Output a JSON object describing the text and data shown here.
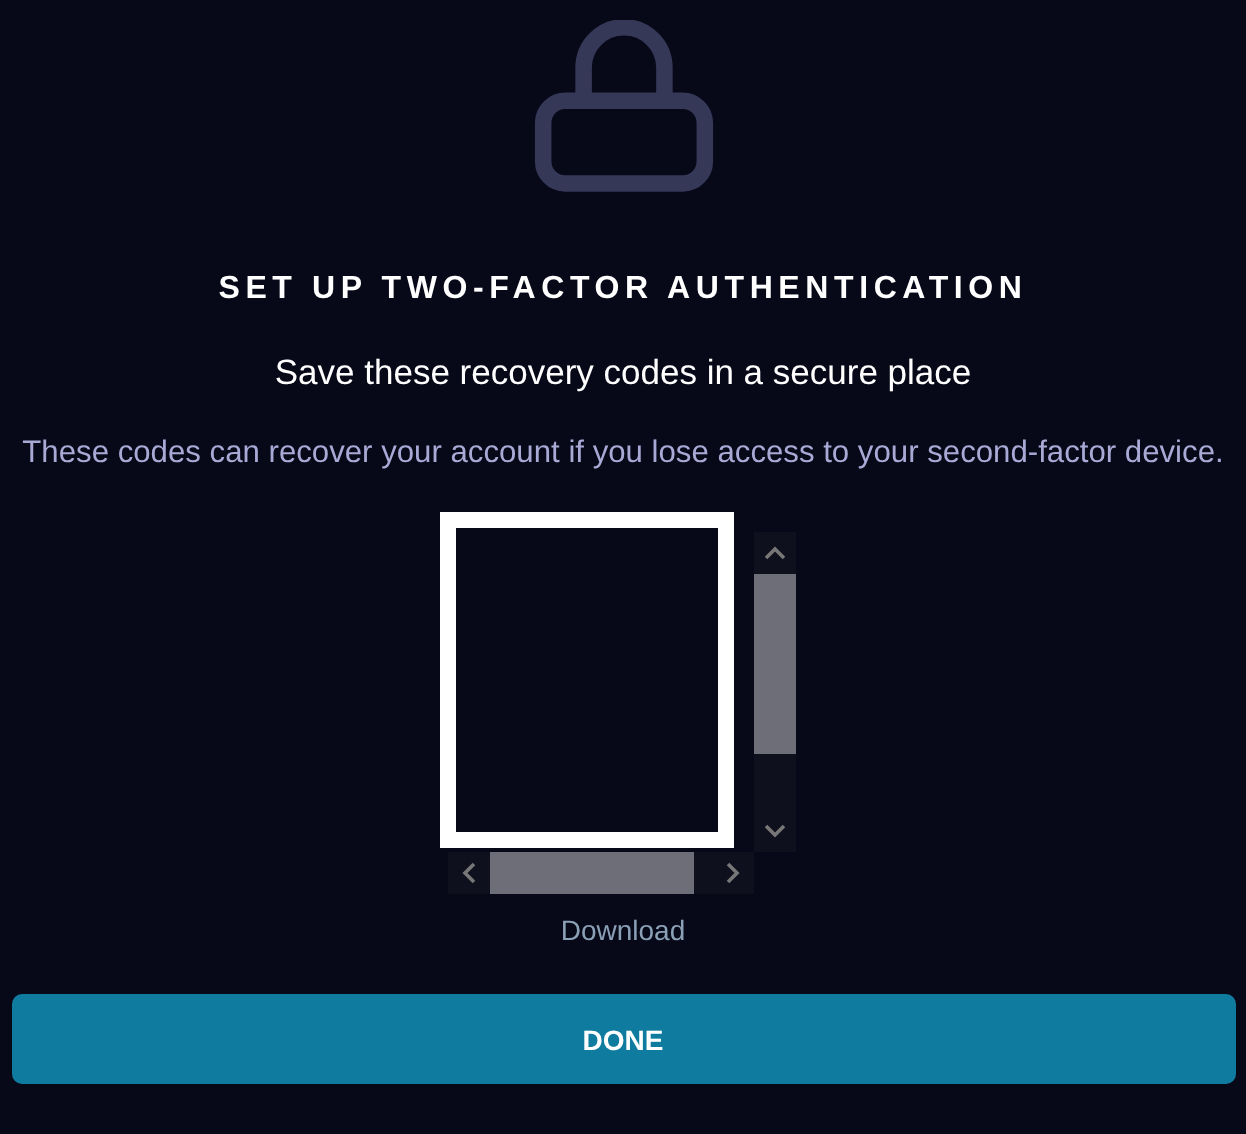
{
  "title": "SET UP TWO-FACTOR AUTHENTICATION",
  "subtitle": "Save these recovery codes in a secure place",
  "description": "These codes can recover your account if you lose access to your second-factor device.",
  "download_link": "Download",
  "done_button": "DONE"
}
